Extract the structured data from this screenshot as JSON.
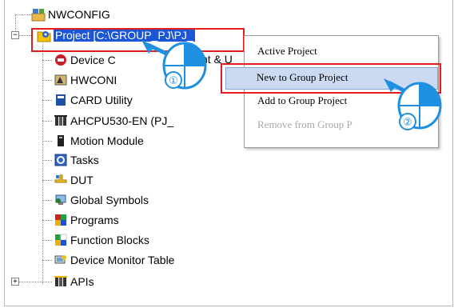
{
  "tree": {
    "root": "NWCONFIG",
    "project": "Project [C:\\GROUP_PJ\\PJ_",
    "children": [
      {
        "label": "Device C",
        "icon": "device-communication-icon"
      },
      {
        "label": "HWCONI",
        "icon": "hwconfig-icon"
      },
      {
        "label": "CARD Utility",
        "icon": "card-utility-icon"
      },
      {
        "label": "AHCPU530-EN  (PJ_",
        "icon": "cpu-module-icon"
      },
      {
        "label": "Motion Module",
        "icon": "motion-module-icon"
      },
      {
        "label": "Tasks",
        "icon": "tasks-icon"
      },
      {
        "label": "DUT",
        "icon": "dut-icon"
      },
      {
        "label": "Global Symbols",
        "icon": "global-symbols-icon"
      },
      {
        "label": "Programs",
        "icon": "programs-icon"
      },
      {
        "label": "Function Blocks",
        "icon": "function-blocks-icon"
      },
      {
        "label": "Device Monitor Table",
        "icon": "device-monitor-table-icon"
      },
      {
        "label": "APIs",
        "icon": "apis-icon"
      }
    ],
    "hidden_fragment": "nt & U"
  },
  "menu": {
    "items": [
      {
        "label": "Active Project",
        "enabled": true
      },
      {
        "label": "New to Group Project",
        "enabled": true
      },
      {
        "label": "Add to Group Project",
        "enabled": true
      },
      {
        "label": "Remove from Group P",
        "enabled": false
      }
    ]
  },
  "callouts": {
    "one": "①",
    "two": "②"
  },
  "colors": {
    "selection": "#1a56d6",
    "highlight_box": "#e11d1d",
    "callout_blue": "#1f8fe0"
  }
}
